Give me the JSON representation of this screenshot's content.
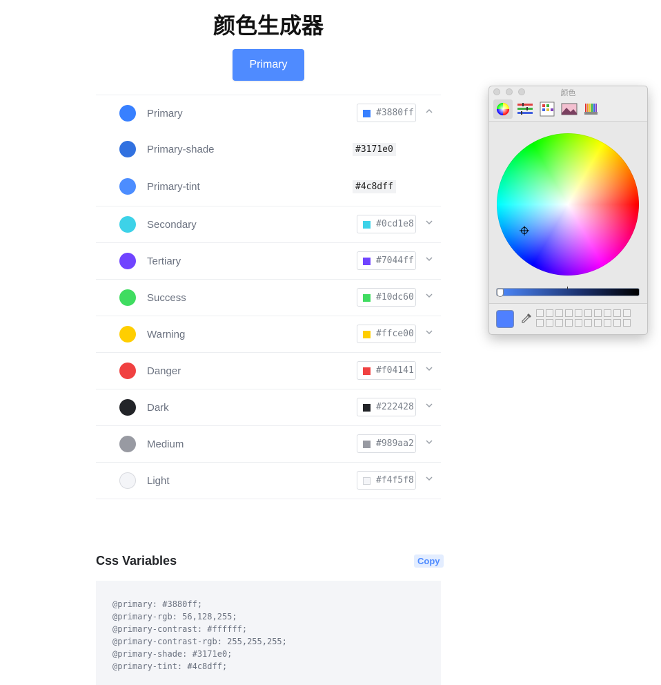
{
  "page": {
    "title": "颜色生成器"
  },
  "primary_button": {
    "label": "Primary"
  },
  "colors": [
    {
      "name": "Primary",
      "hex": "#3880ff",
      "color": "#3880ff",
      "expanded": true,
      "variants": [
        {
          "name": "Primary-shade",
          "hex": "#3171e0",
          "color": "#3171e0"
        },
        {
          "name": "Primary-tint",
          "hex": "#4c8dff",
          "color": "#4c8dff"
        }
      ]
    },
    {
      "name": "Secondary",
      "hex": "#0cd1e8",
      "color": "#3dd2e8"
    },
    {
      "name": "Tertiary",
      "hex": "#7044ff",
      "color": "#7044ff"
    },
    {
      "name": "Success",
      "hex": "#10dc60",
      "color": "#3fdc60"
    },
    {
      "name": "Warning",
      "hex": "#ffce00",
      "color": "#ffce00"
    },
    {
      "name": "Danger",
      "hex": "#f04141",
      "color": "#f04141"
    },
    {
      "name": "Dark",
      "hex": "#222428",
      "color": "#222428"
    },
    {
      "name": "Medium",
      "hex": "#989aa2",
      "color": "#989aa2"
    },
    {
      "name": "Light",
      "hex": "#f4f5f8",
      "color": "#f4f5f8"
    }
  ],
  "css_variables": {
    "title": "Css Variables",
    "copy_label": "Copy",
    "lines": [
      "@primary: #3880ff;",
      "@primary-rgb: 56,128,255;",
      "@primary-contrast: #ffffff;",
      "@primary-contrast-rgb: 255,255,255;",
      "@primary-shade: #3171e0;",
      "@primary-tint: #4c8dff;"
    ]
  },
  "color_picker": {
    "title": "颜色",
    "current_color": "#4f80ff",
    "tools": [
      "color-wheel-icon",
      "sliders-icon",
      "palettes-icon",
      "image-palette-icon",
      "pencils-icon"
    ]
  }
}
